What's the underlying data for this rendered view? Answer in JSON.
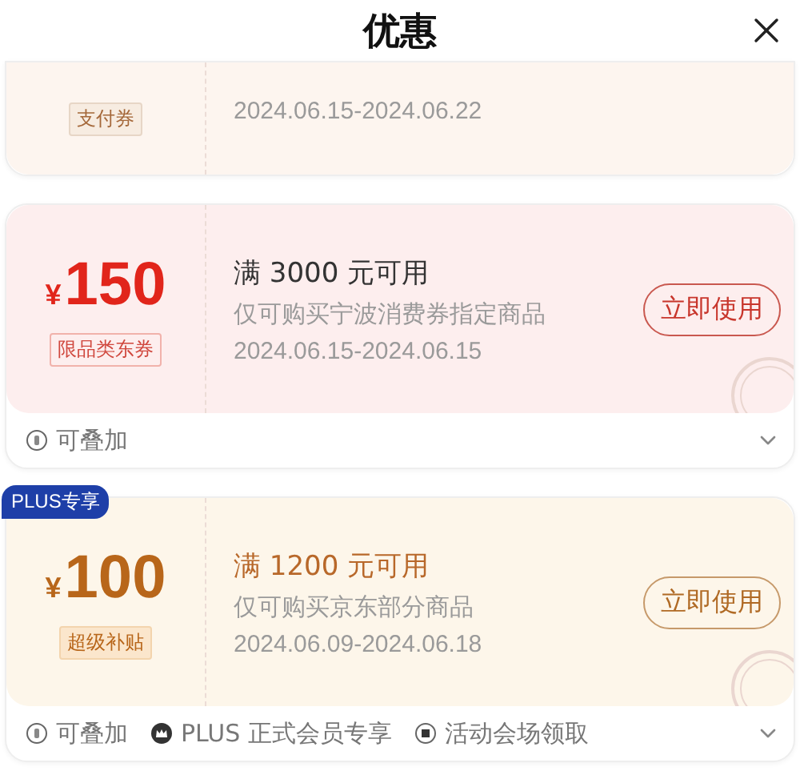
{
  "header": {
    "title": "优惠"
  },
  "coupons": [
    {
      "kind": "clipped",
      "tag": "支付券",
      "date": "2024.06.15-2024.06.22"
    },
    {
      "kind": "standard",
      "currency": "¥",
      "amount": "150",
      "tag": "限品类东券",
      "condition": "满 3000 元可用",
      "scope": "仅可购买宁波消费券指定商品",
      "date": "2024.06.15-2024.06.15",
      "button": "立即使用",
      "footer": [
        {
          "kind": "stack",
          "text": "可叠加"
        }
      ]
    },
    {
      "kind": "plus",
      "badge": "PLUS专享",
      "currency": "¥",
      "amount": "100",
      "tag": "超级补贴",
      "condition": "满 1200 元可用",
      "scope": "仅可购买京东部分商品",
      "date": "2024.06.09-2024.06.18",
      "button": "立即使用",
      "footer": [
        {
          "kind": "stack",
          "text": "可叠加"
        },
        {
          "kind": "crown",
          "text": "PLUS 正式会员专享"
        },
        {
          "kind": "venue",
          "text": "活动会场领取"
        }
      ]
    }
  ]
}
